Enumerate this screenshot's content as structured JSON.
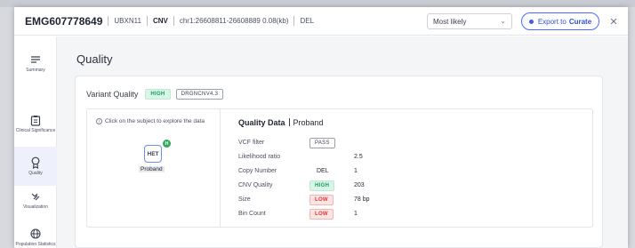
{
  "header": {
    "sample_id": "EMG607778649",
    "gene": "UBXN11",
    "type": "CNV",
    "region": "chr1:26608811-26608889 0.08(kb)",
    "variant_class": "DEL",
    "select_value": "Most likely",
    "export_label": "Export to",
    "export_target": "Curate",
    "close": "✕"
  },
  "sidebar": {
    "items": [
      {
        "label": "Summary"
      },
      {
        "label": "Clinical Significance"
      },
      {
        "label": "Quality"
      },
      {
        "label": "Visualization"
      },
      {
        "label": "Population Statistics"
      }
    ]
  },
  "main": {
    "title": "Quality",
    "variant_quality_label": "Variant Quality",
    "variant_quality_badge": "HIGH",
    "caller_badge": "DRGNCNV4.3",
    "hint": "Click on the subject to explore the data",
    "subject": {
      "genotype": "HET",
      "dot": "H",
      "name": "Proband"
    },
    "quality_data_title": "Quality Data",
    "quality_data_subject": "Proband",
    "rows": [
      {
        "key": "VCF filter",
        "mid": "PASS",
        "value": ""
      },
      {
        "key": "Likelihood ratio",
        "mid": "",
        "value": "2.5"
      },
      {
        "key": "Copy Number",
        "mid": "DEL",
        "value": "1"
      },
      {
        "key": "CNV Quality",
        "mid": "HIGH",
        "value": "203"
      },
      {
        "key": "Size",
        "mid": "LOW",
        "value": "78 bp"
      },
      {
        "key": "Bin Count",
        "mid": "LOW",
        "value": "1"
      }
    ]
  },
  "colors": {
    "accent": "#4a6cf7",
    "high": "#1a9c5f",
    "low": "#d23a3a"
  }
}
